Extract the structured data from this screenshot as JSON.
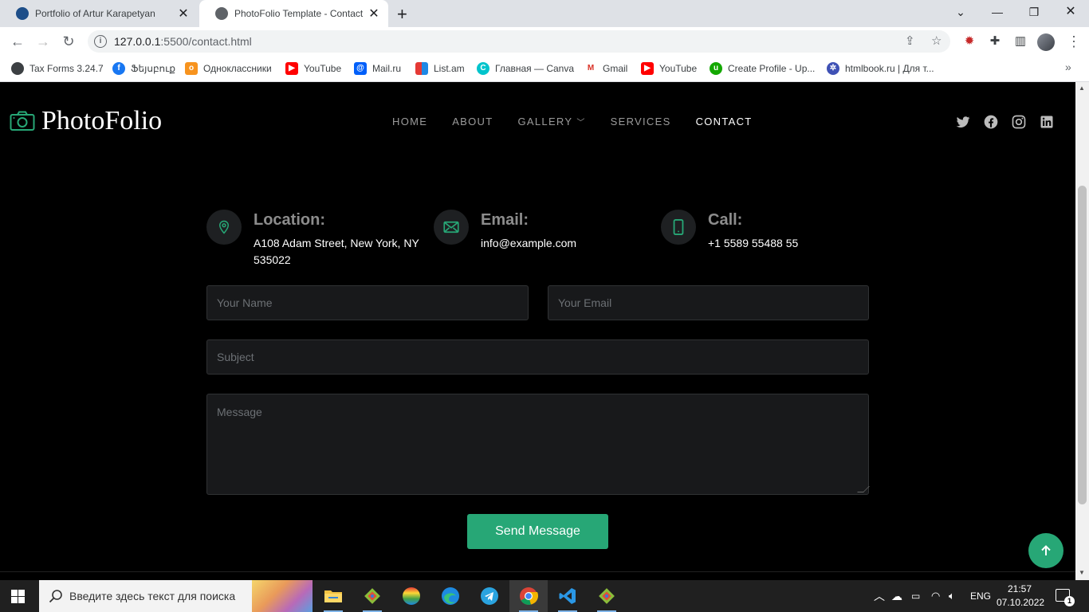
{
  "browser": {
    "tabs": [
      {
        "title": "Portfolio of Artur Karapetyan",
        "active": false
      },
      {
        "title": "PhotoFolio Template - Contact",
        "active": true
      }
    ],
    "url_host": "127.0.0.1",
    "url_path": ":5500/contact.html",
    "bookmarks": [
      "Tax Forms 3.24.7",
      "Ֆեյսբուք",
      "Одноклассники",
      "YouTube",
      "Mail.ru",
      "List.am",
      "Главная — Canva",
      "Gmail",
      "YouTube",
      "Create Profile - Up...",
      "htmlbook.ru | Для т..."
    ]
  },
  "site": {
    "logo": "PhotoFolio",
    "nav": [
      "HOME",
      "ABOUT",
      "GALLERY",
      "SERVICES",
      "CONTACT"
    ],
    "active_nav": "CONTACT",
    "social_icons": [
      "twitter-icon",
      "facebook-icon",
      "instagram-icon",
      "linkedin-icon"
    ],
    "accent_color": "#27a776",
    "info": [
      {
        "title": "Location:",
        "text": "A108 Adam Street, New York, NY 535022",
        "icon": "location-pin-icon"
      },
      {
        "title": "Email:",
        "text": "info@example.com",
        "icon": "envelope-icon"
      },
      {
        "title": "Call:",
        "text": "+1 5589 55488 55",
        "icon": "phone-icon"
      }
    ],
    "form": {
      "name_placeholder": "Your Name",
      "email_placeholder": "Your Email",
      "subject_placeholder": "Subject",
      "message_placeholder": "Message",
      "submit_label": "Send Message"
    }
  },
  "taskbar": {
    "search_placeholder": "Введите здесь текст для поиска",
    "language": "ENG",
    "time": "21:57",
    "date": "07.10.2022",
    "notification_count": "1"
  }
}
